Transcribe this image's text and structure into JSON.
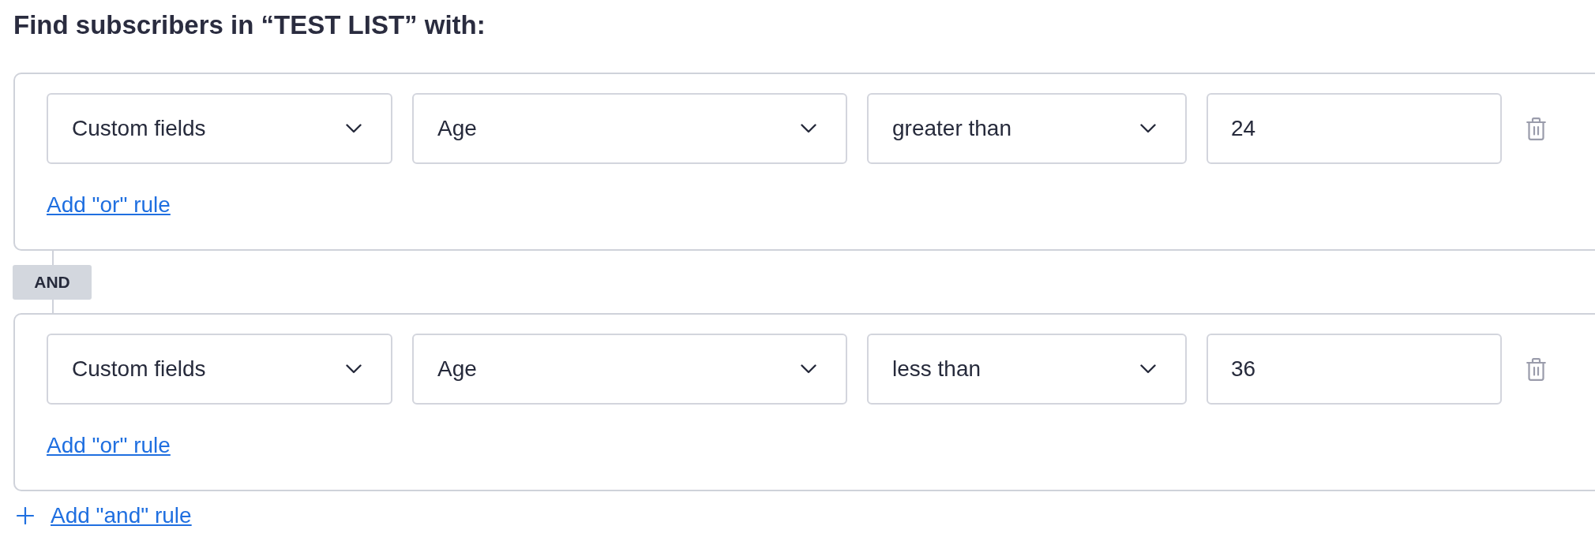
{
  "heading": "Find subscribers in “TEST LIST” with:",
  "groups": [
    {
      "rules": [
        {
          "field_type": "Custom fields",
          "field": "Age",
          "operator": "greater than",
          "value": "24"
        }
      ],
      "add_or_link": "Add \"or\" rule"
    },
    {
      "joiner": "AND",
      "rules": [
        {
          "field_type": "Custom fields",
          "field": "Age",
          "operator": "less than",
          "value": "36"
        }
      ],
      "add_or_link": "Add \"or\" rule"
    }
  ],
  "add_and_link": "Add \"and\" rule"
}
